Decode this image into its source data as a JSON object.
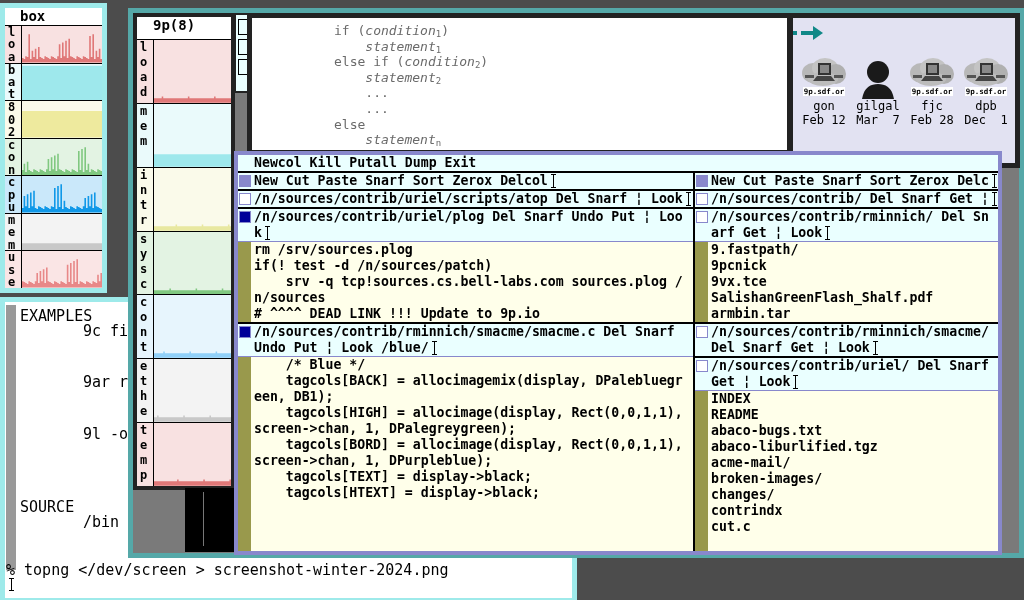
{
  "stats_box": {
    "title": "box",
    "rows": [
      {
        "label": "loa",
        "kind": "spiky",
        "color": "#e07878"
      },
      {
        "label": "bat",
        "kind": "full",
        "color": "#9ee8ec"
      },
      {
        "label": "802",
        "kind": "high",
        "color": "#eeea9e"
      },
      {
        "label": "con",
        "kind": "spiky",
        "color": "#80c880"
      },
      {
        "label": "cpu",
        "kind": "spiky",
        "color": "#1098e8"
      },
      {
        "label": "mem",
        "kind": "low",
        "color": "#c8c8c8"
      },
      {
        "label": "use",
        "kind": "spiky",
        "color": "#e88888"
      }
    ]
  },
  "shell": {
    "sections": [
      {
        "heading": "EXAMPLES",
        "items": [
          "9c fi",
          "9ar r",
          "9l -o"
        ]
      },
      {
        "heading": "SOURCE",
        "items": [
          "/bin"
        ]
      }
    ],
    "prompt": "% topng </dev/screen > screenshot-winter-2024.png"
  },
  "stats_9p": {
    "title": "9p(8)",
    "rows": [
      {
        "label": "load",
        "kind": "floor",
        "color": "#e07878"
      },
      {
        "label": "mem",
        "kind": "low",
        "color": "#9ee8ec"
      },
      {
        "label": "intr",
        "kind": "floor",
        "color": "#e8e8a0"
      },
      {
        "label": "sysc",
        "kind": "floor",
        "color": "#80c880"
      },
      {
        "label": "cont",
        "kind": "floor",
        "color": "#90d0f8"
      },
      {
        "label": "ethe",
        "kind": "floor",
        "color": "#c8c8c8"
      },
      {
        "label": "temp",
        "kind": "floor",
        "color": "#e07878"
      }
    ]
  },
  "text_window": {
    "lines": [
      "if (*condition*$_{1}$)",
      "    *statement*$_{1}$",
      "else if (*condition*$_{2}$)",
      "    *statement*$_{2}$",
      "    ...",
      "    ...",
      "else",
      "    *statement*$_{n}$"
    ]
  },
  "faces": {
    "entries": [
      {
        "kind": "server",
        "label": "9p.sdf.or",
        "name": "gon",
        "date": "Feb 12"
      },
      {
        "kind": "portrait",
        "name": "gilgal",
        "date": "Mar  7"
      },
      {
        "kind": "server",
        "label": "9p.sdf.or",
        "name": "fjc",
        "date": "Feb 28"
      },
      {
        "kind": "server",
        "label": "9p.sdf.or",
        "name": "dpb",
        "date": "Dec  1"
      }
    ]
  },
  "acme": {
    "row_tag": "Newcol Kill Putall Dump Exit",
    "columns": [
      {
        "tag": "New Cut Paste Snarf Sort Zerox Delcol",
        "windows": [
          {
            "tag": "/n/sources/contrib/uriel/scripts/atop Del Snarf ¦ Look",
            "dirty": false
          },
          {
            "tag": "/n/sources/contrib/uriel/plog Del Snarf Undo Put ¦ Look",
            "dirty": true,
            "lines": [
              "rm /srv/sources.plog",
              "if(! test -d /n/sources/patch)",
              "    srv -q tcp!sources.cs.bell-labs.com sources.plog /n/sources",
              "# ^^^^ DEAD LINK !!! Update to 9p.io"
            ]
          },
          {
            "tag": "/n/sources/contrib/rminnich/smacme/smacme.c Del Snarf Undo Put ¦ Look /blue/",
            "dirty": true,
            "lines": [
              "    /* Blue */",
              "    tagcols[BACK] = allocimagemix(display, DPalebluegreen, DB1);",
              "    tagcols[HIGH] = allocimage(display, Rect(0,0,1,1), screen->chan, 1, DPalegreygreen);",
              "    tagcols[BORD] = allocimage(display, Rect(0,0,1,1), screen->chan, 1, DPurpleblue);",
              "    tagcols[TEXT] = display->black;",
              "    tagcols[HTEXT] = display->black;"
            ]
          }
        ]
      },
      {
        "tag": "New Cut Paste Snarf Sort Zerox Delc",
        "windows": [
          {
            "tag": "/n/sources/contrib/ Del Snarf Get ¦",
            "dirty": false
          },
          {
            "tag": "/n/sources/contrib/rminnich/ Del Snarf Get ¦ Look",
            "dirty": false,
            "lines": [
              "9.fastpath/",
              "9pcnick",
              "9vx.tce",
              "SalishanGreenFlash_Shalf.pdf",
              "armbin.tar"
            ]
          },
          {
            "tag": "/n/sources/contrib/rminnich/smacme/ Del Snarf Get ¦ Look",
            "dirty": false
          },
          {
            "tag": "/n/sources/contrib/uriel/ Del Snarf Get ¦ Look",
            "dirty": false,
            "lines": [
              "INDEX",
              "README",
              "abaco-bugs.txt",
              "abaco-liburlified.tgz",
              "acme-mail/",
              "broken-images/",
              "changes/",
              "contrindx",
              "cut.c"
            ]
          }
        ]
      }
    ]
  }
}
